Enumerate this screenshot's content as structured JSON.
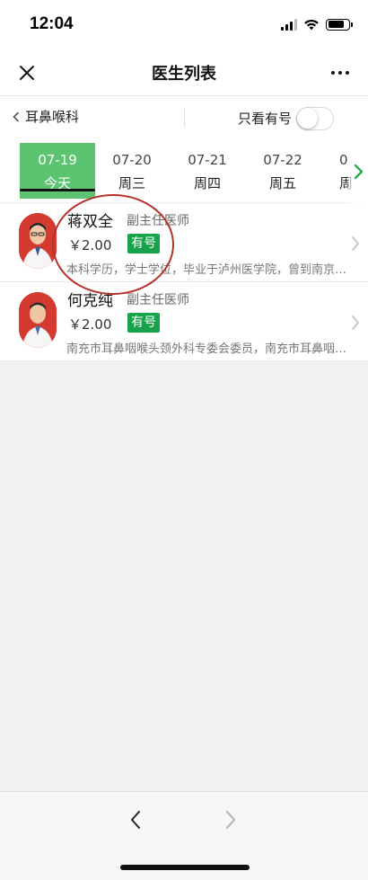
{
  "status_bar": {
    "time": "12:04"
  },
  "nav": {
    "title": "医生列表"
  },
  "filter": {
    "department": "耳鼻喉科",
    "only_available_label": "只看有号",
    "only_available_on": false
  },
  "date_tabs": [
    {
      "date": "07-19",
      "weekday": "今天",
      "active": true
    },
    {
      "date": "07-20",
      "weekday": "周三",
      "active": false
    },
    {
      "date": "07-21",
      "weekday": "周四",
      "active": false
    },
    {
      "date": "07-22",
      "weekday": "周五",
      "active": false
    },
    {
      "date": "0",
      "weekday": "周",
      "active": false
    }
  ],
  "doctors": [
    {
      "name": "蒋双全",
      "title": "副主任医师",
      "fee": "￥2.00",
      "availability": "有号",
      "description": "本科学历，学士学位，毕业于泸州医学院，曾到南京进修学习"
    },
    {
      "name": "何克纯",
      "title": "副主任医师",
      "fee": "￥2.00",
      "availability": "有号",
      "description": "南充市耳鼻咽喉头颈外科专委会委员，南充市耳鼻咽喉学会委员"
    }
  ],
  "colors": {
    "accent_green": "#5cc470",
    "badge_green": "#16a34a",
    "annotation_red": "#b5312a"
  }
}
